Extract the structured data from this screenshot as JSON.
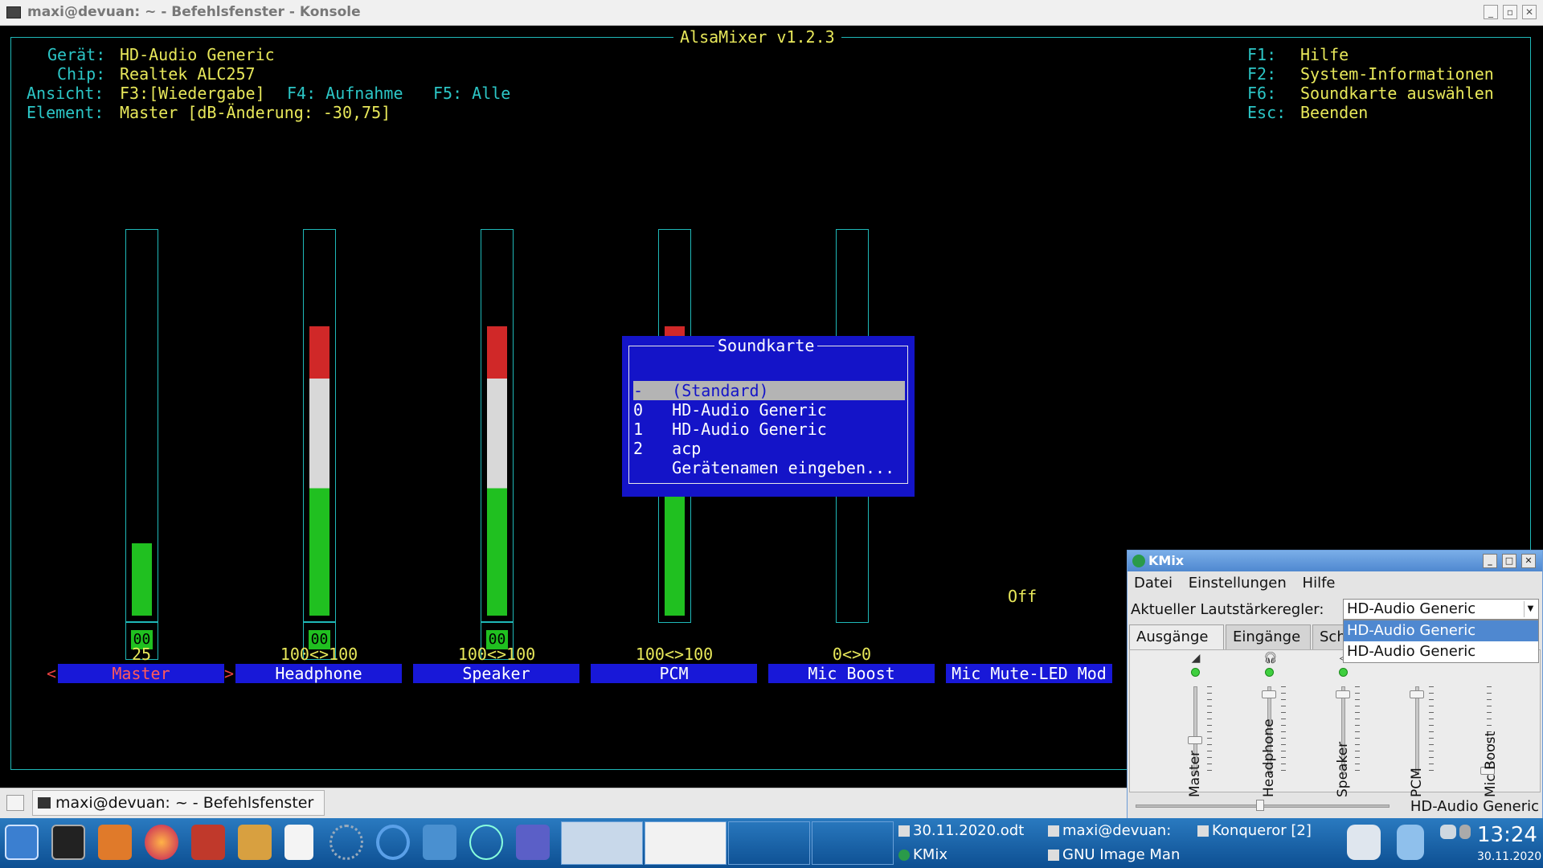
{
  "window": {
    "title": "maxi@devuan: ~ - Befehlsfenster - Konsole"
  },
  "alsamixer": {
    "title": "AlsaMixer v1.2.3",
    "geraet_label": "Gerät:",
    "geraet_value": "HD-Audio Generic",
    "chip_label": "Chip:",
    "chip_value": "Realtek ALC257",
    "ansicht_label": "Ansicht:",
    "ansicht_f3": "F3:[Wiedergabe]",
    "ansicht_f4": "F4: Aufnahme",
    "ansicht_f5": "F5: Alle",
    "element_label": "Element:",
    "element_value": "Master [dB-Änderung: -30,75]",
    "help": [
      {
        "key": "F1:",
        "text": "Hilfe"
      },
      {
        "key": "F2:",
        "text": "System-Informationen"
      },
      {
        "key": "F6:",
        "text": "Soundkarte auswählen"
      },
      {
        "key": "Esc:",
        "text": "Beenden"
      }
    ],
    "controls": [
      {
        "name": "Master",
        "value_text": "25",
        "box": "00",
        "level": 0.25,
        "selected": true
      },
      {
        "name": "Headphone",
        "value_text": "100<>100",
        "box": "00",
        "level": 1.0
      },
      {
        "name": "Speaker",
        "value_text": "100<>100",
        "box": "00",
        "level": 1.0
      },
      {
        "name": "PCM",
        "value_text": "100<>100",
        "level": 1.0
      },
      {
        "name": "Mic Boost",
        "value_text": "0<>0",
        "level": 0.0
      },
      {
        "name": "Mic Mute-LED Mod",
        "value_text": "Off"
      }
    ],
    "cursor_left": "<",
    "cursor_right": ">",
    "dialog": {
      "title": "Soundkarte",
      "items": [
        {
          "idx": "-",
          "label": "(Standard)"
        },
        {
          "idx": "0",
          "label": "HD-Audio Generic"
        },
        {
          "idx": "1",
          "label": "HD-Audio Generic"
        },
        {
          "idx": "2",
          "label": "acp"
        },
        {
          "idx": "",
          "label": "Gerätenamen eingeben..."
        }
      ]
    }
  },
  "konsole_tab": {
    "label": "maxi@devuan: ~ - Befehlsfenster"
  },
  "kmix": {
    "title": "KMix",
    "menu": [
      "Datei",
      "Einstellungen",
      "Hilfe"
    ],
    "regler_label": "Aktueller Lautstärkeregler:",
    "regler_value": "HD-Audio Generic",
    "dropdown_options": [
      "HD-Audio Generic",
      "HD-Audio Generic"
    ],
    "tabs": [
      "Ausgänge",
      "Eingänge",
      "Sch"
    ],
    "channels": [
      {
        "name": "Master",
        "icon": "speaker-icon",
        "level": 0.38
      },
      {
        "name": "Headphone",
        "icon": "headphone-icon",
        "level": 0.95
      },
      {
        "name": "Speaker",
        "icon": "speaker-icon",
        "level": 0.95
      },
      {
        "name": "PCM",
        "icon": "none",
        "level": 0.95
      },
      {
        "name": "Mic Boost",
        "icon": "none",
        "level": 0.0
      }
    ],
    "bottom_device": "HD-Audio Generic"
  },
  "taskbar": {
    "tasks": [
      {
        "label": "30.11.2020.odt"
      },
      {
        "label": "maxi@devuan:"
      },
      {
        "label": "Konqueror [2]"
      },
      {
        "label": "KMix"
      },
      {
        "label": "GNU Image Man"
      }
    ],
    "clock": "13:24",
    "date": "30.11.2020"
  }
}
